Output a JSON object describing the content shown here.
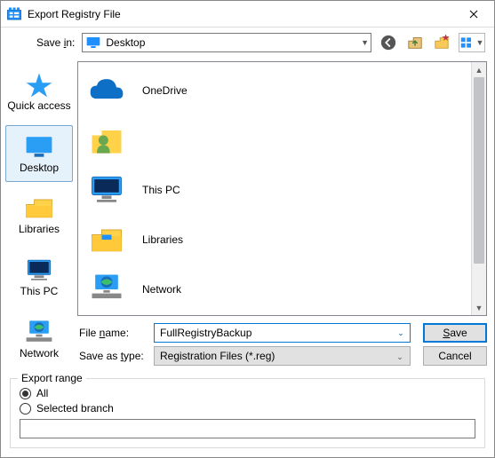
{
  "title": "Export Registry File",
  "toolbar": {
    "savein_label": "Save in:",
    "savein_value": "Desktop",
    "icons": [
      "back",
      "up",
      "new-folder",
      "view-menu"
    ]
  },
  "places": [
    {
      "id": "quickaccess",
      "label": "Quick access"
    },
    {
      "id": "desktop",
      "label": "Desktop",
      "selected": true
    },
    {
      "id": "libraries",
      "label": "Libraries"
    },
    {
      "id": "thispc",
      "label": "This PC"
    },
    {
      "id": "network",
      "label": "Network"
    }
  ],
  "file_list": [
    {
      "type": "onedrive",
      "label": "OneDrive"
    },
    {
      "type": "user",
      "label": ""
    },
    {
      "type": "thispc",
      "label": "This PC"
    },
    {
      "type": "libraries",
      "label": "Libraries"
    },
    {
      "type": "network",
      "label": "Network"
    }
  ],
  "form": {
    "filename_label": "File name:",
    "filename_value": "FullRegistryBackup",
    "type_label": "Save as type:",
    "type_value": "Registration Files (*.reg)"
  },
  "buttons": {
    "save": "Save",
    "cancel": "Cancel"
  },
  "export_range": {
    "legend": "Export range",
    "all": {
      "label": "All",
      "checked": true
    },
    "selected_branch": {
      "label": "Selected branch",
      "checked": false
    },
    "branch_value": ""
  }
}
